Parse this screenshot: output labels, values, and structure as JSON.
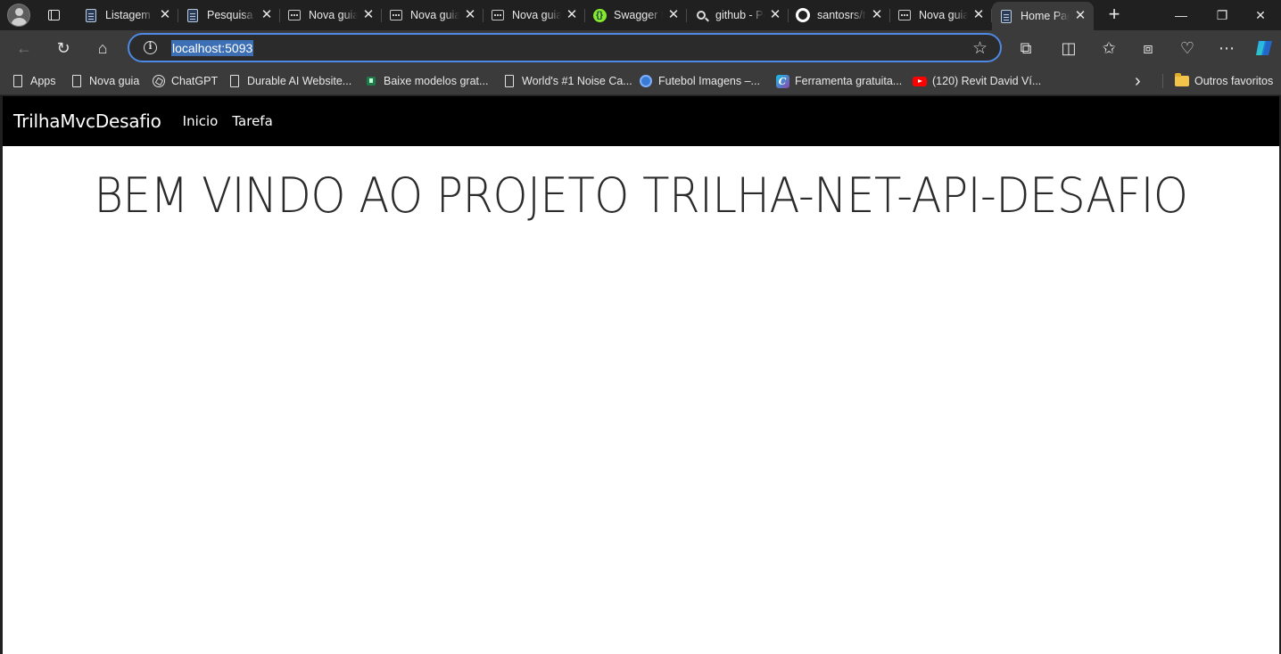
{
  "browser": {
    "tabs": [
      {
        "title": "Listagem de Tarefas",
        "favicon": "document-icon",
        "active": false
      },
      {
        "title": "Pesquisa por",
        "favicon": "document-icon",
        "active": false
      },
      {
        "title": "Nova guia",
        "favicon": "new-tab-icon",
        "active": false
      },
      {
        "title": "Nova guia",
        "favicon": "new-tab-icon",
        "active": false
      },
      {
        "title": "Nova guia",
        "favicon": "new-tab-icon",
        "active": false
      },
      {
        "title": "Swagger UI",
        "favicon": "swagger-icon",
        "active": false
      },
      {
        "title": "github - Pesquisar",
        "favicon": "search-icon",
        "active": false
      },
      {
        "title": "santosrs/trilha",
        "favicon": "github-icon",
        "active": false
      },
      {
        "title": "Nova guia",
        "favicon": "new-tab-icon",
        "active": false
      },
      {
        "title": "Home Page",
        "favicon": "document-icon",
        "active": true
      }
    ],
    "close_glyph": "✕",
    "new_tab_glyph": "+",
    "window_controls": {
      "minimize": "—",
      "maximize": "❐",
      "close": "✕"
    },
    "address": {
      "url": "localhost:5093",
      "info_glyph": "i",
      "favorite_glyph": "☆"
    },
    "toolbar_glyphs": {
      "back": "←",
      "refresh": "↻",
      "home": "⌂",
      "extensions": "⧉",
      "split": "◫",
      "favorites": "✩",
      "collections": "⧈",
      "health": "♡",
      "more": "⋯"
    },
    "bookmarks": [
      {
        "label": "Apps",
        "icon": "grid-icon"
      },
      {
        "label": "Nova guia",
        "icon": "page-icon"
      },
      {
        "label": "ChatGPT",
        "icon": "chatgpt-icon"
      },
      {
        "label": "Durable AI Website...",
        "icon": "page-icon"
      },
      {
        "label": "Baixe modelos grat...",
        "icon": "green-icon"
      },
      {
        "label": "World's #1 Noise Ca...",
        "icon": "page-icon"
      },
      {
        "label": "Futebol Imagens –...",
        "icon": "ball-icon"
      },
      {
        "label": "Ferramenta gratuita...",
        "icon": "canva-icon"
      },
      {
        "label": "(120) Revit David Ví...",
        "icon": "youtube-icon"
      }
    ],
    "bookmarks_overflow_glyph": "›",
    "other_favorites": "Outros favoritos"
  },
  "page": {
    "brand": "TrilhaMvcDesafio",
    "nav": [
      "Inicio",
      "Tarefa"
    ],
    "heading": "BEM VINDO AO PROJETO TRILHA-NET-API-DESAFIO"
  },
  "colors": {
    "chrome_bg": "#202020",
    "toolbar_bg": "#3b3b3b",
    "address_focus": "#4f89e6",
    "navbar_bg": "#000000",
    "page_bg": "#ffffff"
  }
}
